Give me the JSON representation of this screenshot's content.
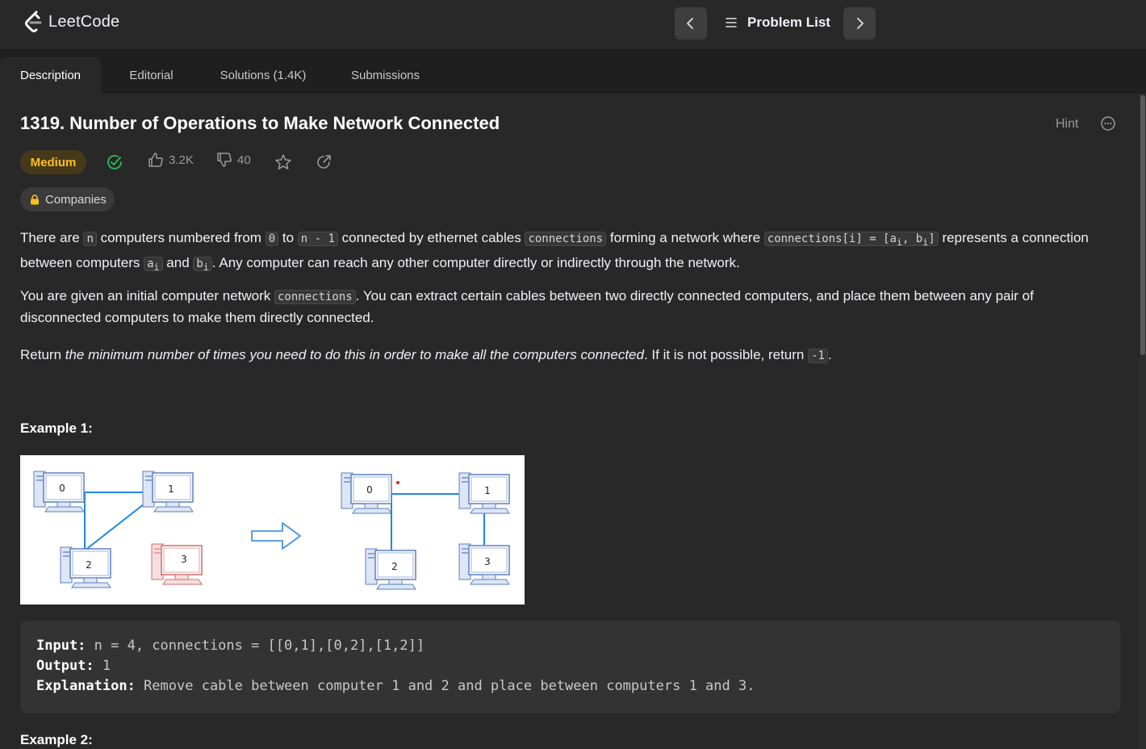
{
  "app": {
    "logo_text": "LeetCode"
  },
  "topnav": {
    "problem_list_label": "Problem List"
  },
  "tabs": [
    {
      "label": "Description"
    },
    {
      "label": "Editorial"
    },
    {
      "label": "Solutions (1.4K)"
    },
    {
      "label": "Submissions"
    }
  ],
  "problem": {
    "title": "1319. Number of Operations to Make Network Connected",
    "hint_label": "Hint",
    "difficulty": "Medium",
    "likes": "3.2K",
    "dislikes": "40",
    "companies_label": "Companies",
    "p1": {
      "t1": "There are ",
      "c1": "n",
      "t2": " computers numbered from ",
      "c2": "0",
      "t3": " to ",
      "c3": "n - 1",
      "t4": " connected by ethernet cables ",
      "c4": "connections",
      "t5": " forming a network where ",
      "c5": "connections[i] = [a",
      "c5_sub1": "i",
      "c5_mid": ", b",
      "c5_sub2": "i",
      "c5_end": "]",
      "t6": " represents a connection between computers ",
      "c6": "a",
      "c6_sub": "i",
      "t7": " and ",
      "c7": "b",
      "c7_sub": "i",
      "t8": ". Any computer can reach any other computer directly or indirectly through the network."
    },
    "p2": {
      "t1": "You are given an initial computer network ",
      "c1": "connections",
      "t2": ". You can extract certain cables between two directly connected computers, and place them between any pair of disconnected computers to make them directly connected."
    },
    "p3": {
      "t1": "Return ",
      "em": "the minimum number of times you need to do this in order to make all the computers connected",
      "t2": ". If it is not possible, return ",
      "c1": "-1",
      "t3": "."
    },
    "example1_heading": "Example 1:",
    "example1": {
      "input_label": "Input:",
      "input_value": " n = 4, connections = [[0,1],[0,2],[1,2]]",
      "output_label": "Output:",
      "output_value": " 1",
      "explanation_label": "Explanation:",
      "explanation_value": " Remove cable between computer 1 and 2 and place between computers 1 and 3."
    },
    "example2_heading": "Example 2:"
  },
  "diagram": {
    "left_nodes": [
      "0",
      "1",
      "2",
      "3"
    ],
    "right_nodes": [
      "0",
      "1",
      "2",
      "3"
    ]
  },
  "colors": {
    "medium_text": "#ffc01e",
    "medium_bg": "#45391a",
    "solved_check": "#2cbb5d",
    "edge_blue": "#1e88e5",
    "disconnected_red": "#e57373"
  }
}
